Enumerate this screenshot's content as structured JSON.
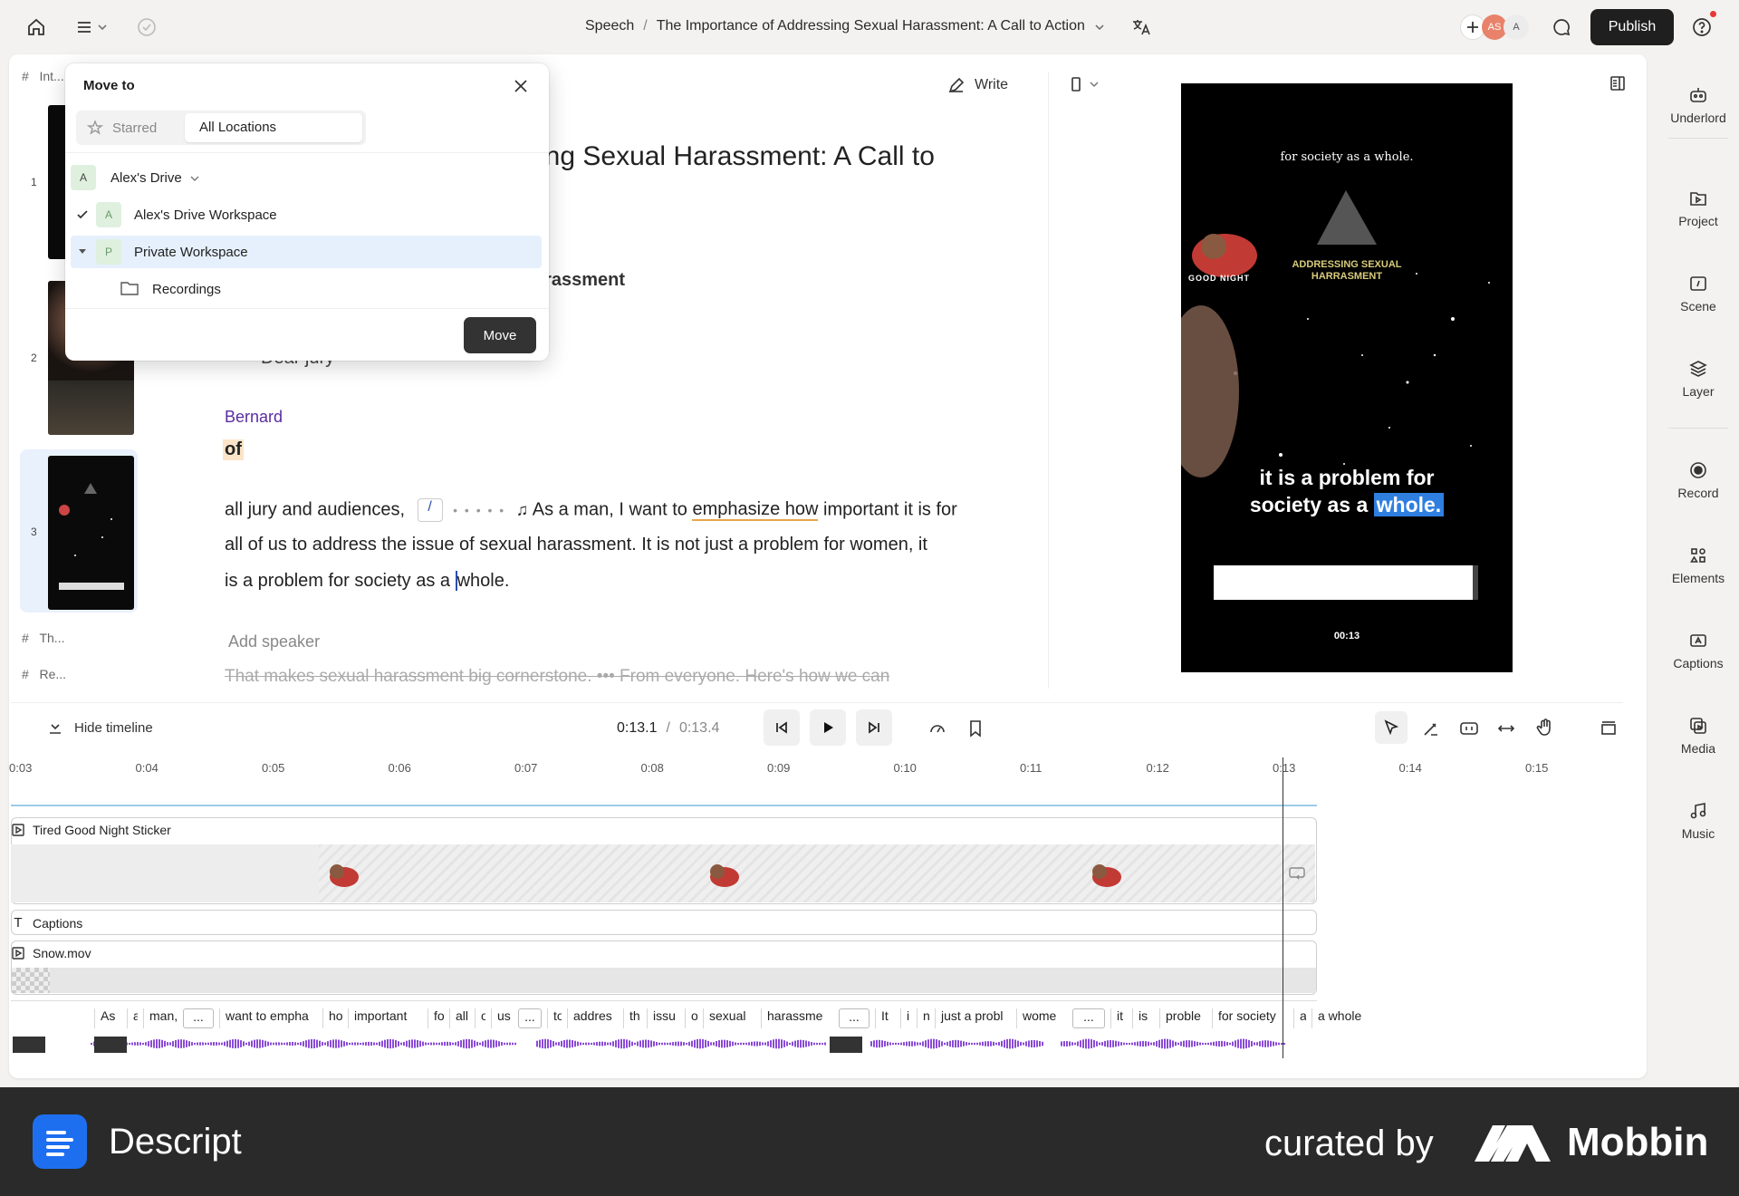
{
  "topbar": {
    "breadcrumb_root": "Speech",
    "breadcrumb_sep": "/",
    "breadcrumb_title": "The Importance of Addressing Sexual Harassment: A Call to Action",
    "publish_label": "Publish",
    "avatar_as": "AS",
    "avatar_a": "A"
  },
  "right_sidebar": {
    "items": [
      {
        "label": "Underlord"
      },
      {
        "label": "Project"
      },
      {
        "label": "Scene"
      },
      {
        "label": "Layer"
      },
      {
        "label": "Record"
      },
      {
        "label": "Elements"
      },
      {
        "label": "Captions"
      },
      {
        "label": "Media"
      },
      {
        "label": "Music"
      }
    ]
  },
  "scenes": {
    "header_label": "Int...",
    "hash": "#",
    "numbers": [
      "1",
      "2",
      "3"
    ],
    "other_labels": [
      "Th...",
      "Re..."
    ]
  },
  "editor": {
    "write_label": "Write",
    "title_fragment": "sing Sexual Harassment: A Call to",
    "subheading_fragment": "arassment",
    "dear_jury": "Dear jury",
    "speaker": "Bernard",
    "of_word": "of",
    "line1a": "all jury and audiences,",
    "line1b": "As a man, I want to ",
    "line1c": "emphasize how",
    "line1d": " important it is for",
    "line2": "all of us to address the issue of sexual harassment.",
    "line2b": "It is not just a problem for women, it",
    "line3a": "is a problem for society as a ",
    "line3b": "whole.",
    "add_speaker": "Add speaker",
    "strike_line": "That makes sexual harassment big cornerstone. ••• From everyone. Here's how we can"
  },
  "preview": {
    "top_caption": "for society as a whole.",
    "logo_line1": "ADDRESSING SEXUAL",
    "logo_line2": "HARRASMENT",
    "sticker_text": "GOOD NIGHT",
    "caption_line1": "it is a problem for",
    "caption_line2a": "society as a ",
    "caption_line2b": "whole.",
    "timer": "00:13"
  },
  "transport": {
    "hide_timeline": "Hide timeline",
    "current_time": "0:13.1",
    "time_sep": "/",
    "total_time": "0:13.4"
  },
  "timeline": {
    "ticks": [
      "0:03",
      "0:04",
      "0:05",
      "0:06",
      "0:07",
      "0:08",
      "0:09",
      "0:10",
      "0:11",
      "0:12",
      "0:13",
      "0:14",
      "0:15"
    ],
    "tracks": {
      "sticker": "Tired Good Night Sticker",
      "captions": "Captions",
      "snow": "Snow.mov"
    },
    "words": [
      "As",
      "a",
      "man,",
      "...",
      "want to empha",
      "ho",
      "important",
      "fo",
      "all",
      "o",
      "us",
      "...",
      "to",
      "addres",
      "th",
      "issu",
      "o",
      "sexual",
      "harassme",
      "...",
      "It",
      "i",
      "n",
      "just a probl",
      "wome",
      "...",
      "it",
      "is",
      "proble",
      "for society",
      "a",
      "a whole"
    ]
  },
  "dialog": {
    "title": "Move to",
    "tab_starred": "Starred",
    "tab_all": "All Locations",
    "drive": "Alex's Drive",
    "drive_badge": "A",
    "ws1": "Alex's Drive Workspace",
    "ws1_badge": "A",
    "ws2": "Private Workspace",
    "ws2_badge": "P",
    "folder": "Recordings",
    "move_button": "Move"
  },
  "footer": {
    "brand": "Descript",
    "curated": "curated by",
    "mobbin": "Mobbin"
  },
  "colors": {
    "accent_purple": "#5a2ca0",
    "selection_blue": "#e6f0fc",
    "waveform": "#8a4bd6",
    "dark_button": "#1f1f1f"
  }
}
